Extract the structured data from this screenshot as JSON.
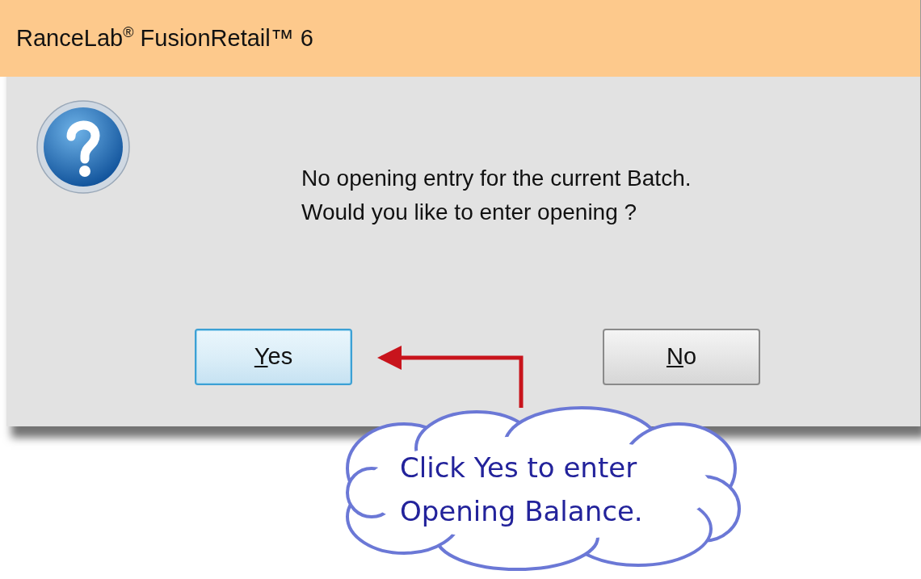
{
  "window": {
    "title": "RanceLab$^{®}$ FusionRetail™ 6"
  },
  "message": {
    "lines": [
      "No opening entry for the current Batch.",
      "Would you like to enter opening ?"
    ]
  },
  "buttons": [
    {
      "label": "Yes",
      "default": true,
      "mnemonic": true
    },
    {
      "label": "No",
      "default": false,
      "mnemonic": true
    }
  ],
  "callout": {
    "text": "Click Yes to enter\nOpening Balance."
  }
}
